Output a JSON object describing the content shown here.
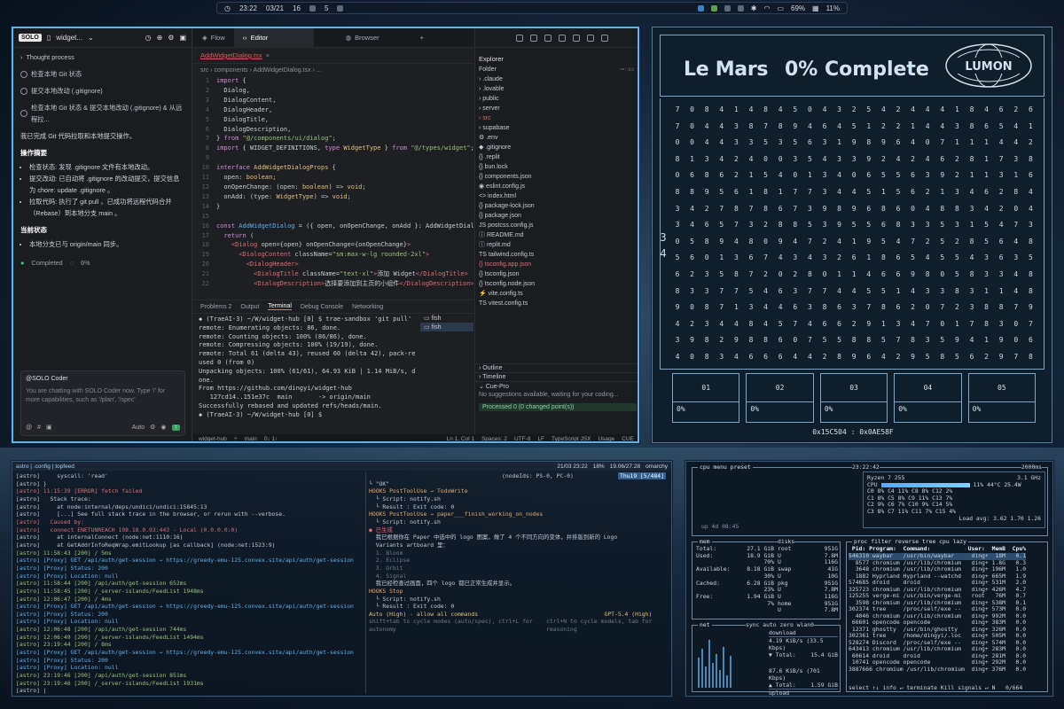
{
  "topbar": {
    "time": "23:22",
    "date": "03/21",
    "workspace1": "16",
    "workspace2": "5",
    "battery": "69%",
    "cpu": "11%"
  },
  "ide": {
    "solo": {
      "badge": "SOLO",
      "title": "widget...",
      "thought": "Thought process",
      "action1": "检查本地 Git 状态",
      "action2": "提交本地改动 (.gitignore)",
      "action3": "检查本地 Git 状态 & 提交本地改动 (.gitignore) & 从远程拉...",
      "summary": "我已完成 Git 代码拉取和本地提交操作。",
      "ops_title": "操作摘要",
      "op1": "检查状态: 发现 .gitignore 文件有本地改动。",
      "op2": "提交改动: 已自动将 .gitignore 的改动提交，提交信息为 chore: update .gitignore 。",
      "op3": "拉取代码: 执行了 git pull ，已成功将远程代码合并（Rebase）到本地分支 main 。",
      "state_title": "当前状态",
      "state1": "本地分支已与 origin/main 同步。",
      "completed": "Completed",
      "progress": "6%",
      "chat_label": "@SOLO Coder",
      "chat_placeholder": "You are chatting with SOLO Coder now. Type '/' for more capabilities, such as '/plan', '/spec'",
      "mode": "Auto"
    },
    "tabs": [
      {
        "label": "Flow"
      },
      {
        "label": "Editor"
      },
      {
        "label": "Browser"
      }
    ],
    "file_tab": "AddWidgetDialog.tsx",
    "breadcrumb": "src › components › AddWidgetDialog.tsx › ...",
    "panel_tabs": [
      "Problems 2",
      "Output",
      "Terminal",
      "Debug Console",
      "Networking"
    ],
    "terminal_lines": [
      "◆ (TraeAI-3) ~/W/widget-hub [0] $ trae-sandbox 'git pull'",
      "remote: Enumerating objects: 86, done.",
      "remote: Counting objects: 100% (86/86), done.",
      "remote: Compressing objects: 100% (19/19), done.",
      "remote: Total 61 (delta 43), reused 60 (delta 42), pack-re",
      "used 0 (from 0)",
      "Unpacking objects: 100% (61/61), 64.93 KiB | 1.14 MiB/s, d",
      "one.",
      "From https://github.com/dingyi/widget-hub",
      "   127cd14..151e37c  main       -> origin/main",
      "Successfully rebased and updated refs/heads/main.",
      "◆ (TraeAI-3) ~/W/widget-hub [0] $ "
    ],
    "term_shells": [
      "fish",
      "fish"
    ],
    "explorer": {
      "title": "Explorer",
      "folder": "Folder",
      "items": [
        {
          "name": "› .claude"
        },
        {
          "name": "› .lovable"
        },
        {
          "name": "› public"
        },
        {
          "name": "› server"
        },
        {
          "name": "› src",
          "mod": true
        },
        {
          "name": "› supabase"
        },
        {
          "name": "⚙ .env"
        },
        {
          "name": "◆ .gitignore"
        },
        {
          "name": "{} .replit"
        },
        {
          "name": "{} bun.lock"
        },
        {
          "name": "{} components.json"
        },
        {
          "name": "◉ eslint.config.js"
        },
        {
          "name": "<> index.html"
        },
        {
          "name": "{} package-lock.json"
        },
        {
          "name": "{} package.json"
        },
        {
          "name": "JS postcss.config.js"
        },
        {
          "name": "ⓘ README.md"
        },
        {
          "name": "ⓘ replit.md"
        },
        {
          "name": "TS tailwind.config.ts"
        },
        {
          "name": "{} tsconfig.app.json",
          "mod": true
        },
        {
          "name": "{} tsconfig.json"
        },
        {
          "name": "{} tsconfig.node.json"
        },
        {
          "name": "⚡ vite.config.ts"
        },
        {
          "name": "TS vitest.config.ts"
        }
      ],
      "outline": "Outline",
      "timeline": "Timeline",
      "cuepro": "Cue-Pro",
      "cue_msg": "No suggestions available, waiting for your coding...",
      "processed": "Processed 0 (0 changed point(s))"
    },
    "status": {
      "project": "widget-hub",
      "branch": "main",
      "sync": "0↓ 1↑",
      "cursor": "Ln 1, Col 1",
      "spaces": "Spaces: 2",
      "enc": "UTF-8",
      "eol": "LF",
      "lang": "TypeScript JSX",
      "usage": "Usage",
      "cue": "CUE"
    }
  },
  "code_lines": [
    {
      "n": "1",
      "h": "<span class=\"kw\">import</span> {"
    },
    {
      "n": "2",
      "h": "  Dialog,"
    },
    {
      "n": "3",
      "h": "  DialogContent,"
    },
    {
      "n": "4",
      "h": "  DialogHeader,"
    },
    {
      "n": "5",
      "h": "  DialogTitle,"
    },
    {
      "n": "6",
      "h": "  DialogDescription,"
    },
    {
      "n": "7",
      "h": "} <span class=\"kw\">from</span> <span class=\"str\">\"@/components/ui/dialog\"</span>;"
    },
    {
      "n": "8",
      "h": "<span class=\"kw\">import</span> { WIDGET_DEFINITIONS, <span class=\"kw\">type</span> <span class=\"ty\">WidgetType</span> } <span class=\"kw\">from</span> <span class=\"str\">\"@/types/widget\"</span>;"
    },
    {
      "n": "9",
      "h": ""
    },
    {
      "n": "10",
      "h": "<span class=\"kw\">interface</span> <span class=\"ty\">AddWidgetDialogProps</span> {"
    },
    {
      "n": "11",
      "h": "  open: <span class=\"ty\">boolean</span>;"
    },
    {
      "n": "12",
      "h": "  onOpenChange: (open: <span class=\"ty\">boolean</span>) => <span class=\"ty\">void</span>;"
    },
    {
      "n": "13",
      "h": "  onAdd: (type: <span class=\"ty\">WidgetType</span>) => <span class=\"ty\">void</span>;"
    },
    {
      "n": "14",
      "h": "}"
    },
    {
      "n": "15",
      "h": ""
    },
    {
      "n": "16",
      "h": "<span class=\"kw\">const</span> <span class=\"fn\">AddWidgetDialog</span> = ({ open, onOpenChange, onAdd }: AddWidgetDialogP"
    },
    {
      "n": "17",
      "h": "  <span class=\"kw\">return</span> ("
    },
    {
      "n": "18",
      "h": "    <span class=\"tg\">&lt;Dialog</span> open={open} onOpenChange={onOpenChange}<span class=\"tg\">&gt;</span>"
    },
    {
      "n": "19",
      "h": "      <span class=\"tg\">&lt;DialogContent</span> className=<span class=\"str\">\"sm:max-w-lg rounded-2xl\"</span><span class=\"tg\">&gt;</span>"
    },
    {
      "n": "20",
      "h": "        <span class=\"tg\">&lt;DialogHeader&gt;</span>"
    },
    {
      "n": "21",
      "h": "          <span class=\"tg\">&lt;DialogTitle</span> className=<span class=\"str\">\"text-xl\"</span><span class=\"tg\">&gt;</span>添加 Widget<span class=\"tg\">&lt;/DialogTitle&gt;</span>"
    },
    {
      "n": "22",
      "h": "          <span class=\"tg\">&lt;DialogDescription&gt;</span>选择要添加到主页的小组件<span class=\"tg\">&lt;/DialogDescription&gt;</span>"
    }
  ],
  "lumon": {
    "name": "Le Mars",
    "complete": "0% Complete",
    "logo": "LUMON",
    "bins": [
      {
        "label": "01",
        "pct": "0%"
      },
      {
        "label": "02",
        "pct": "0%"
      },
      {
        "label": "03",
        "pct": "0%"
      },
      {
        "label": "04",
        "pct": "0%"
      },
      {
        "label": "05",
        "pct": "0%"
      }
    ],
    "hex": "0x15C504 : 0x0AE58F",
    "grid_rows": [
      "7 0 8 4 1 4 8 4 5 0 4 3 2 5 4 2 4 4 4 1 8 4 6 2 6",
      "7 0 4 4 3 8 7 8 9 4 6 4 5 1 2 2 1 4 4 3 8 6 5 4 1",
      "0 0 4 4 3 3 5 3 5 6 3 1 9 8 9 6 4 0 7 1 1 1 4 4 2",
      "8 1 3 4 2 4 0 0 3 5 4 3 3 9 2 4 2 4 6 2 8 1 7 3 8",
      "0 6 8 6 2 1 5 4 0 1 3 4 0 6 5 5 6 3 9 2 1 1 3 1 6",
      "8 8 9 5 6 1 8 1 7 7 3 4 4 5 1 5 6 2 1 3 4 6 2 8 4",
      "3 4 2 7 8 7 8 6 7 3 9 8 9 6 8 6 0 4 8 8 3 4 2 0 4",
      "3 4 6 5 7 3 2 8 8 5 3 9 5 5 6 8 3 3 5 3 1 5 4 7 3",
      "0 5 8 9 4 8 0 9 4 7 2 4 1 9 5 4 7 2 5 2 8 5 6 4 8",
      "5 6 0 1 3 6 7 4 3 4 3 2 6 1 8 6 5 4 5 5 4 3 6 3 5",
      "6 2 3 5 8 7 2 0 2 8 0 1 1 4 6 6 9 8 0 5 8 3 3 4 8",
      "8 3 3 7 7 5 4 6 3 7 7 4 4 5 5 1 4 3 3 8 3 1 1 4 8",
      "9 0 8 7 1 3 4 4 6 3 8 6 3 7 8 6 2 0 7 2 3 8 8 7 9",
      "4 2 3 4 4 8 4 5 7 4 6 6 2 9 1 3 4 7 0 1 7 8 3 0 7",
      "3 9 8 2 9 8 8 6 0 7 5 5 8 8 5 7 8 3 5 9 4 1 9 0 6",
      "4 0 8 3 4 6 6 6 4 4 2 8 9 6 4 2 9 5 8 5 6 2 9 7 8"
    ],
    "big1": "3",
    "big2": "4"
  },
  "tmux": {
    "bar_left": "astro | .config | topfeed",
    "bar_date": "21/03 23:22",
    "bar_pct": "18%",
    "bar_time": "19.06/27.28",
    "bar_host": "omarchy",
    "left_lines": [
      "[astro]     syscall: 'read'",
      "[astro] }",
      "[astro] 11:15:39 [ERROR] fetch failed",
      "[astro]   Stack trace:",
      "[astro]     at node:internal/deps/undici/undici:15845:13",
      "[astro]     [...] See full stack trace in the browser, or rerun with --verbose.",
      "[astro]   Caused by:",
      "[astro]   connect ENETUNREACH 198.18.0.93:443 - Local (0.0.0.0:0)",
      "[astro]     at internalConnect (node:net:1110:16)",
      "[astro]     at GetAddrInfoReqWrap.emitLookup [as callback] (node:net:1523:9)",
      "[astro] 11:58:43 [200] / 5ms",
      "[astro] [Proxy] GET /api/auth/get-session → https://greedy-emu-125.convex.site/api/auth/get-session",
      "[astro] [Proxy] Status: 200",
      "[astro] [Proxy] Location: null",
      "[astro] 11:58:44 [200] /api/auth/get-session 652ms",
      "[astro] 11:58:45 [200] /_server-islands/FeedList 1948ms",
      "[astro] 12:06:47 [200] / 4ms",
      "[astro] [Proxy] GET /api/auth/get-session → https://greedy-emu-125.convex.site/api/auth/get-session",
      "[astro] [Proxy] Status: 200",
      "[astro] [Proxy] Location: null",
      "[astro] 12:06:48 [200] /api/auth/get-session 744ms",
      "[astro] 12:06:49 [200] /_server-islands/FeedList 1494ms",
      "[astro] 23:19:44 [200] / 8ms",
      "[astro] [Proxy] GET /api/auth/get-session → https://greedy-emu-125.convex.site/api/auth/get-session",
      "[astro] [Proxy] Status: 200",
      "[astro] [Proxy] Location: null",
      "[astro] 23:19:46 [200] /api/auth/get-session 851ms",
      "[astro] 23:19:46 [200] /_server-islands/FeedList 1931ms",
      "[astro] |"
    ],
    "right_lines": [
      "",
      "                                       (nodeIds: PS-0, PC-0)",
      "└ \"OK\"",
      "",
      "HOOKS PostToolUse → TodoWrite",
      "  └ Script: notify.sh",
      "  └ Result : Exit code: 0",
      "",
      "HOOKS PostToolUse → paper___finish_working_on_nodes",
      "  └ Script: notify.sh",
      "",
      "● 已生成",
      "",
      "  我已根据你在 Paper 中选中的 logo 图案，做了 4 个不同方向的变体，并排版到新的 Logo",
      "  Variants artboard 里：",
      "",
      "  1. Bloom",
      "  2. Eclipse",
      "  3. Orbit",
      "  4. Signal",
      "",
      "  我已经检查过画面，四个 logo 都已正常生成并显示。",
      "",
      "HOOKS Stop",
      "  └ Script: notify.sh",
      "  └ Result : Exit code: 0",
      "",
      "Auto (High) - allow all commands                                     GPT-5.4 (High)",
      "shift+tab to cycle modes (auto/spec), ctrl+L for    ctrl+N to cycle models, tab for",
      "autonomy                                            reasoning"
    ],
    "right_badge": "Thu19 [5/484]"
  },
  "btop": {
    "header_left": "cpu  menu  preset",
    "time": "23:22:42",
    "interval": "2000ms",
    "model": "Ryzen 7 255",
    "freq": "3.1 GHz",
    "cpu_total": "11%",
    "temp": "44°C 25.4W",
    "load": "Load avg: 3.62 1.70 1.26",
    "uptime": "up 4d 08:45",
    "cores": [
      "C0   8% C4  11% C8   8% C12   2%",
      "C1   8% C5   8% C9  11% C13   7%",
      "C2   9% C6   7% C10   9% C14   5%",
      "C3   8% C7  11% C11   7% C15   4%"
    ],
    "mem": [
      {
        "k": "Total:",
        "v": "27.1 GiB"
      },
      {
        "k": "Used:",
        "v": "18.9 GiB"
      },
      {
        "k": "",
        "v": "70%"
      },
      {
        "k": "Available:",
        "v": "8.18 GiB"
      },
      {
        "k": "",
        "v": "30%"
      },
      {
        "k": "Cached:",
        "v": "6.28 GiB"
      },
      {
        "k": "",
        "v": "23%"
      },
      {
        "k": "Free:",
        "v": "1.94 GiB"
      },
      {
        "k": "",
        "v": "7%"
      }
    ],
    "disks": [
      {
        "k": "root",
        "v": "951G"
      },
      {
        "k": "U",
        "v": "7.8M"
      },
      {
        "k": "U",
        "v": "116G"
      },
      {
        "k": "swap",
        "v": "41G"
      },
      {
        "k": "U",
        "v": "10G"
      },
      {
        "k": "pkg",
        "v": "951G"
      },
      {
        "k": "U",
        "v": "7.8M"
      },
      {
        "k": "U",
        "v": "116G"
      },
      {
        "k": "home",
        "v": "951G"
      },
      {
        "k": "U",
        "v": "7.8M"
      }
    ],
    "net": {
      "head": "sync  auto  zero  wlan0",
      "down": "4.19 KiB/s (33.5 Kbps)",
      "down_total": "15.4 GiB",
      "up": "87.6 KiB/s (701 Kbps)",
      "up_total": "1.59 GiB",
      "dl_label": "download",
      "ul_label": "upload"
    },
    "proc_head": "proc  filter  reverse  tree  cpu lazy",
    "proc_cols": " Pid: Program:  Command:           User:  MemB  Cpu%",
    "procs": [
      "546310 waybar   /usr/bin/waybar     ding+  18M   0.1",
      "  8577 chromium /usr/lib/chromium   ding+ 1.8G   0.3",
      "  3648 chromium /usr/lib/chromium   ding+ 196M   1.0",
      "  1882 Hyprland Hyprland --watchd   ding+ 665M   1.9",
      "574685 droid    droid               ding+ 531M   2.0",
      "325723 chromium /usr/lib/chromium   ding+ 426M   4.7",
      "125255 verge-mi /usr/bin/verge-mi   root   76M   0.7",
      "  3598 chromium /usr/lib/chromium   ding+ 538M   0.1",
      "302374 tree     /proc/self/exe --   ding+ 573M   0.0",
      "  4046 chromium /usr/lib/chromium   ding+ 992M   0.0",
      " 66601 opencode opencode            ding+ 383M   0.0",
      " 12371 ghostty  /usr/bin/ghostty    ding+ 326M   0.0",
      "302361 tree     /home/dingyi/.loc   ding+ 505M   0.0",
      "528274 Discord  /proc/self/exe --   ding+ 574M   0.0",
      "643413 chromium /usr/lib/chromium   ding+ 283M   0.0",
      " 60614 droid    droid               ding+ 281M   0.0",
      " 10741 opencode opencode            ding+ 292M   0.0",
      "3887666 chromium /usr/lib/chromium  ding+ 376M   0.0"
    ],
    "footer": "select ↑↓ info ↵ terminate Kill signals ↵ N   0/664"
  }
}
